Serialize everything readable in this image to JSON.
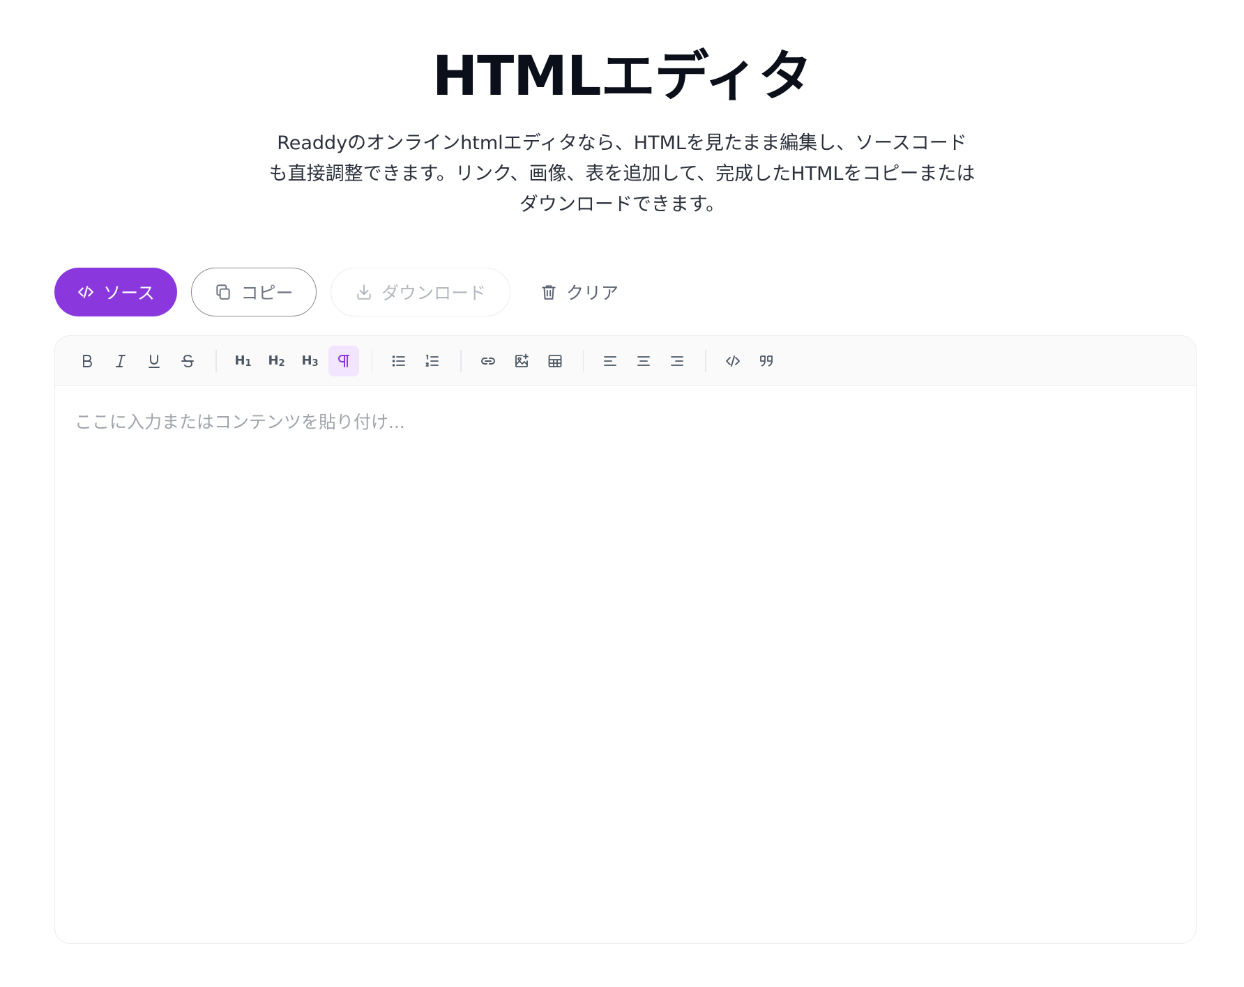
{
  "header": {
    "title": "HTMLエディタ",
    "description_lines": [
      "Readdyのオンラインhtmlエディタなら、HTMLを見たまま編集し、ソースコード",
      "も直接調整できます。リンク、画像、表を追加して、完成したHTMLをコピーまたは",
      "ダウンロードできます。"
    ]
  },
  "actions": {
    "source": "ソース",
    "copy": "コピー",
    "download": "ダウンロード",
    "clear": "クリア"
  },
  "toolbar": {
    "h1": "H",
    "h2": "H",
    "h3": "H",
    "h1_sub": "1",
    "h2_sub": "2",
    "h3_sub": "3",
    "active_item": "paragraph"
  },
  "editor": {
    "placeholder": "ここに入力またはコンテンツを貼り付け..."
  },
  "colors": {
    "accent": "#8a38de",
    "accent_light": "#f1e5ff"
  }
}
